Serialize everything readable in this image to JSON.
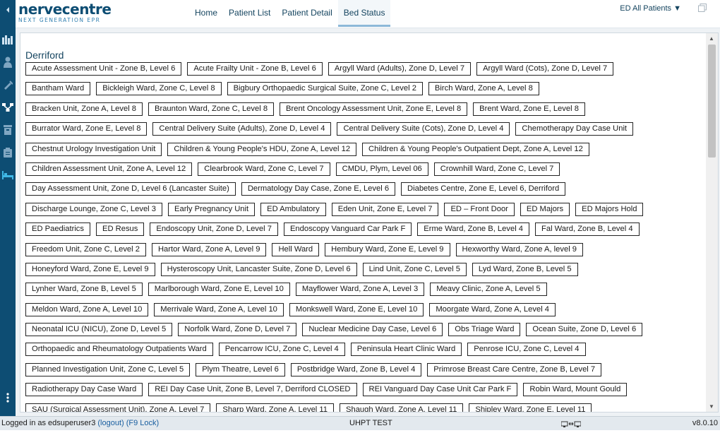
{
  "app": {
    "logo_name": "nervecentre",
    "logo_tagline": "NEXT GENERATION EPR"
  },
  "nav": {
    "items": [
      {
        "label": "Home"
      },
      {
        "label": "Patient List"
      },
      {
        "label": "Patient Detail"
      },
      {
        "label": "Bed Status",
        "active": true
      }
    ]
  },
  "header": {
    "patients_dropdown": "ED All Patients ▼"
  },
  "rail_icons": [
    "collapse-arrow-icon",
    "bed-chart-icon",
    "person-icon",
    "syringe-icon",
    "network-icon",
    "archive-icon",
    "clipboard-icon",
    "bed-icon",
    "more-icon"
  ],
  "site": "Derriford",
  "ward_rows": [
    [
      "Acute Assessment Unit - Zone B, Level 6",
      "Acute Frailty Unit - Zone B, Level 6",
      "Argyll Ward (Adults), Zone D, Level 7",
      "Argyll Ward (Cots), Zone D, Level 7"
    ],
    [
      "Bantham Ward",
      "Bickleigh Ward, Zone C, Level 8",
      "Bigbury Orthopaedic Surgical Suite, Zone C, Level 2",
      "Birch Ward, Zone A, Level 8"
    ],
    [
      "Bracken Unit, Zone A, Level 8",
      "Braunton Ward, Zone C, Level 8",
      "Brent Oncology Assessment Unit, Zone E, Level 8",
      "Brent Ward, Zone E, Level 8"
    ],
    [
      "Burrator Ward, Zone E, Level 8",
      "Central Delivery Suite (Adults), Zone D, Level 4",
      "Central Delivery Suite (Cots), Zone D, Level 4",
      "Chemotherapy Day Case Unit"
    ],
    [
      "Chestnut Urology Investigation Unit",
      "Children & Young People's HDU, Zone A, Level 12",
      "Children & Young People's Outpatient Dept, Zone A, Level 12"
    ],
    [
      "Children Assessment Unit, Zone A, Level 12",
      "Clearbrook Ward, Zone C, Level 7",
      "CMDU, Plym, Level 06",
      "Crownhill Ward, Zone C, Level 7"
    ],
    [
      "Day Assessment Unit, Zone D, Level 6 (Lancaster Suite)",
      "Dermatology Day Case, Zone E, Level 6",
      "Diabetes Centre, Zone E, Level 6, Derriford"
    ],
    [
      "Discharge Lounge, Zone C, Level 3",
      "Early Pregnancy Unit",
      "ED Ambulatory",
      "Eden Unit, Zone E, Level 7",
      "ED – Front Door",
      "ED Majors",
      "ED Majors Hold"
    ],
    [
      "ED Paediatrics",
      "ED Resus",
      "Endoscopy Unit, Zone D, Level 7",
      "Endoscopy Vanguard Car Park F",
      "Erme Ward, Zone B, Level 4",
      "Fal Ward, Zone B, Level 4"
    ],
    [
      "Freedom Unit, Zone C, Level 2",
      "Hartor Ward, Zone A, Level 9",
      "Hell Ward",
      "Hembury Ward, Zone E, Level 9",
      "Hexworthy Ward, Zone A, level 9"
    ],
    [
      "Honeyford Ward, Zone E, Level 9",
      "Hysteroscopy Unit, Lancaster Suite, Zone D, Level 6",
      "Lind Unit, Zone C, Level 5",
      "Lyd Ward, Zone B, Level 5"
    ],
    [
      "Lynher Ward, Zone B, Level 5",
      "Marlborough Ward, Zone E, Level 10",
      "Mayflower Ward, Zone A, Level 3",
      "Meavy Clinic, Zone A, Level 5"
    ],
    [
      "Meldon Ward, Zone A, Level 10",
      "Merrivale Ward, Zone A, Level 10",
      "Monkswell Ward, Zone E, Level 10",
      "Moorgate Ward, Zone A, Level 4"
    ],
    [
      "Neonatal ICU (NICU), Zone D, Level 5",
      "Norfolk Ward, Zone D, Level 7",
      "Nuclear Medicine Day Case, Level 6",
      "Obs Triage Ward",
      "Ocean Suite, Zone D, Level 6"
    ],
    [
      "Orthopaedic and Rheumatology Outpatients Ward",
      "Pencarrow ICU, Zone C, Level 4",
      "Peninsula Heart Clinic Ward",
      "Penrose ICU, Zone C, Level 4"
    ],
    [
      "Planned Investigation Unit, Zone C, Level 5",
      "Plym Theatre, Level 6",
      "Postbridge Ward, Zone B, Level 4",
      "Primrose Breast Care Centre, Zone B, Level 7"
    ],
    [
      "Radiotherapy Day Case Ward",
      "REI Day Case Unit, Zone B, Level 7, Derriford CLOSED",
      "REI Vanguard Day Case Unit Car Park F",
      "Robin Ward, Mount Gould"
    ],
    [
      "SAU (Surgical Assessment Unit), Zone A, Level 7",
      "Sharp Ward, Zone A, Level 11",
      "Shaugh Ward, Zone A, Level 11",
      "Shipley Ward, Zone E, Level 11"
    ]
  ],
  "status": {
    "logged_in_prefix": "Logged in as edsuperuser3",
    "logout": "(logout)",
    "lock": "(F9 Lock)",
    "trust": "UHPT TEST",
    "version": "v8.0.10"
  },
  "colors": {
    "rail": "#0d4d73",
    "brand": "#0d4d73",
    "accent": "#2f7fb0"
  }
}
